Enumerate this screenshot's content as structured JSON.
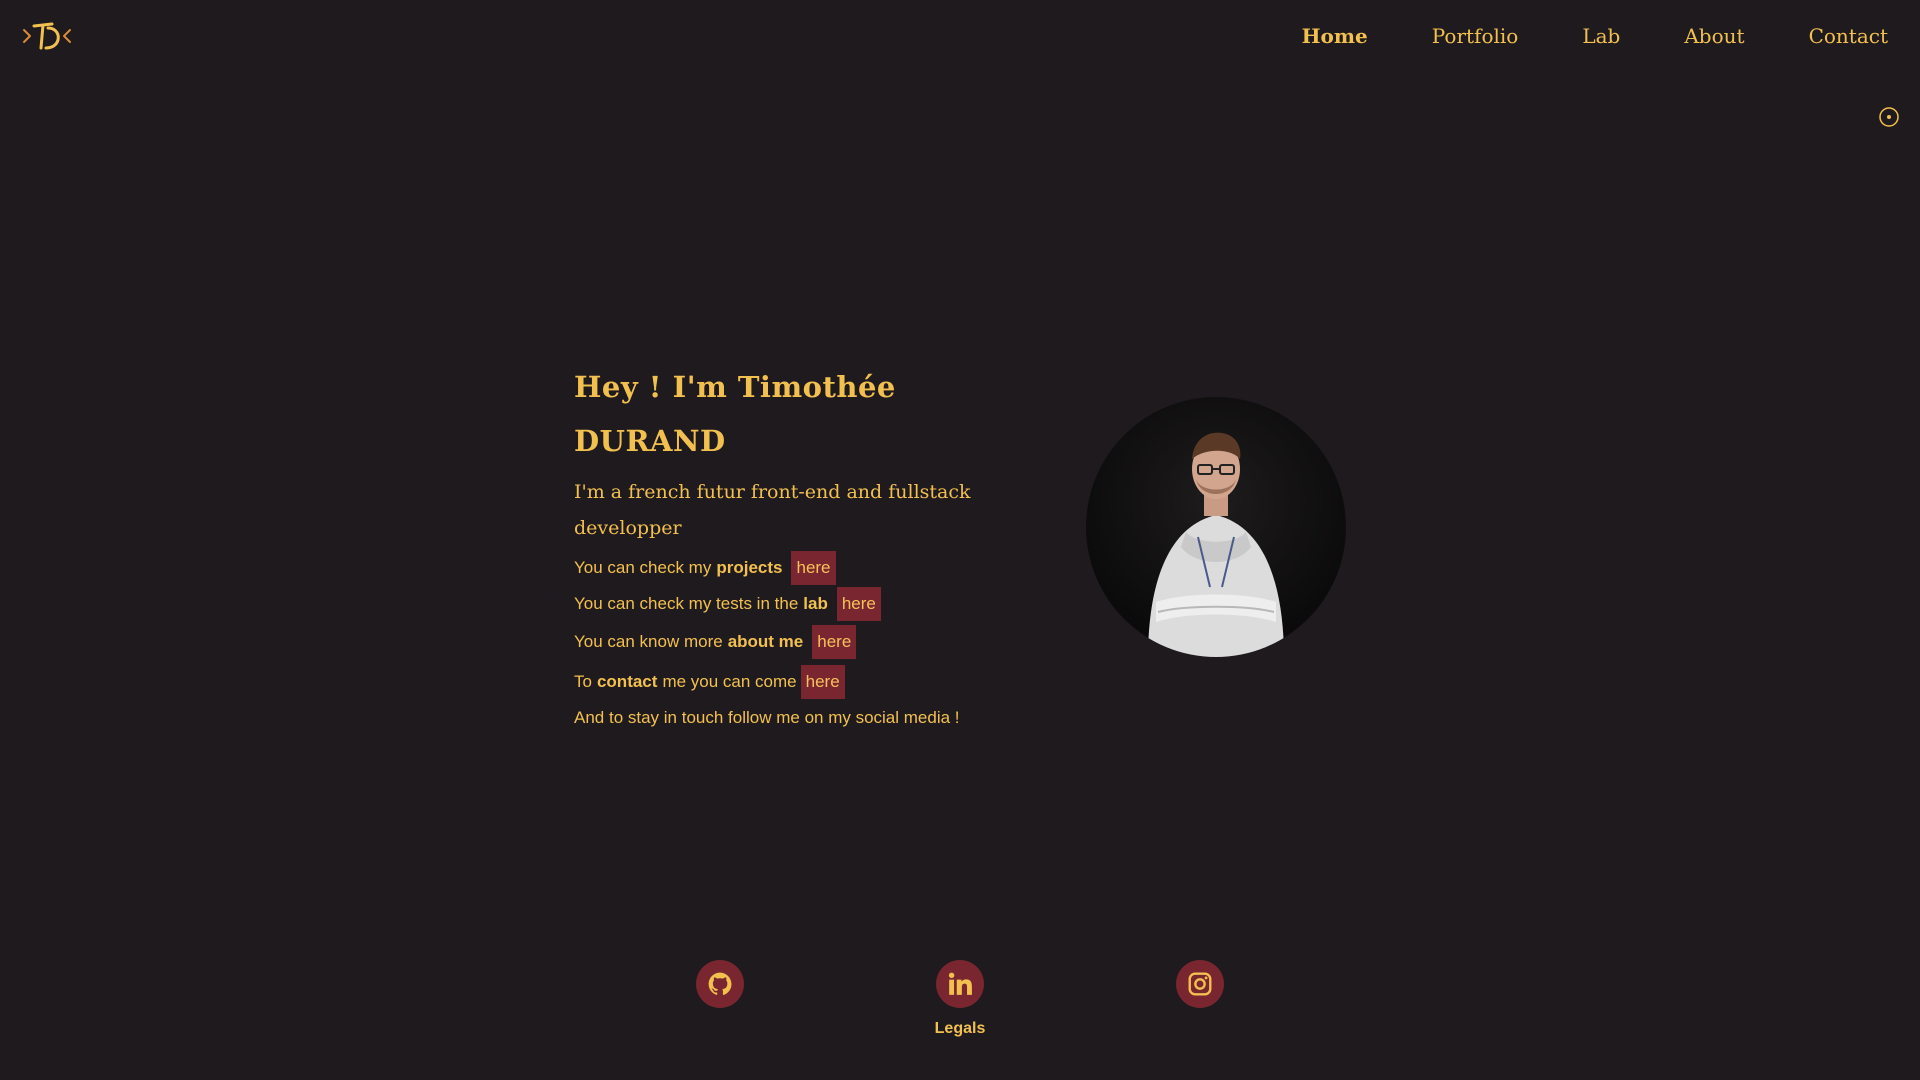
{
  "nav": {
    "items": [
      {
        "label": "Home",
        "active": true
      },
      {
        "label": "Portfolio",
        "active": false
      },
      {
        "label": "Lab",
        "active": false
      },
      {
        "label": "About",
        "active": false
      },
      {
        "label": "Contact",
        "active": false
      }
    ]
  },
  "logo": {
    "icon": "td-logo-icon"
  },
  "theme_toggle": {
    "icon": "sun-toggle-icon"
  },
  "hero": {
    "title_line1": "Hey ! I'm Timothée",
    "title_line2": "DURAND",
    "subtitle": "I'm a french futur front-end and fullstack developper",
    "lines": [
      {
        "before": "You can check my",
        "bold": "projects",
        "after": "",
        "link": "here"
      },
      {
        "before": "You can check my tests in the",
        "bold": "lab",
        "after": "",
        "link": "here"
      },
      {
        "before": "You can know more",
        "bold": "about me",
        "after": "",
        "link": "here"
      },
      {
        "before": "To",
        "bold": "contact",
        "after": "me you can come",
        "link": "here"
      }
    ],
    "closing": "And to stay in touch follow me on my social media !"
  },
  "footer": {
    "socials": [
      {
        "icon": "github-icon"
      },
      {
        "icon": "linkedin-icon"
      },
      {
        "icon": "instagram-icon"
      }
    ],
    "legals": "Legals"
  },
  "colors": {
    "background": "#1f1a1e",
    "accent": "#f2c04f",
    "pill": "#7a2630"
  }
}
